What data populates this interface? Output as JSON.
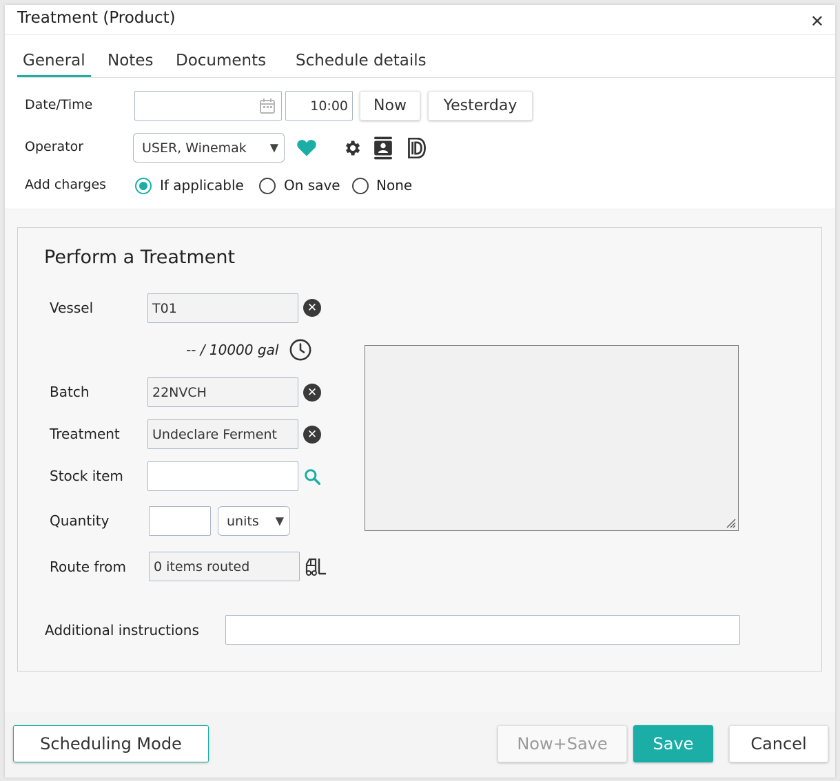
{
  "dialog": {
    "title": "Treatment (Product)",
    "close_glyph": "✕"
  },
  "tabs": [
    {
      "label": "General",
      "active": true
    },
    {
      "label": "Notes"
    },
    {
      "label": "Documents"
    },
    {
      "label": "Schedule details"
    }
  ],
  "header": {
    "datetime_label": "Date/Time",
    "date_value": "",
    "time_value": "10:00",
    "now_label": "Now",
    "yesterday_label": "Yesterday",
    "operator_label": "Operator",
    "operator_value": "USER, Winemak",
    "add_charges_label": "Add charges",
    "charges_options": [
      {
        "label": "If applicable",
        "selected": true
      },
      {
        "label": "On save"
      },
      {
        "label": "None"
      }
    ]
  },
  "form": {
    "heading": "Perform a Treatment",
    "vessel_label": "Vessel",
    "vessel_value": "T01",
    "capacity_text": "-- / 10000 gal",
    "batch_label": "Batch",
    "batch_value": "22NVCH",
    "treatment_label": "Treatment",
    "treatment_value": "Undeclare Ferment",
    "stock_item_label": "Stock item",
    "stock_item_value": "",
    "quantity_label": "Quantity",
    "quantity_value": "",
    "quantity_unit": "units",
    "route_from_label": "Route from",
    "route_from_value": "0 items routed",
    "additional_label": "Additional instructions",
    "additional_value": "",
    "notes_value": ""
  },
  "footer": {
    "scheduling_mode": "Scheduling Mode",
    "now_save": "Now+Save",
    "save": "Save",
    "cancel": "Cancel"
  },
  "colors": {
    "accent": "#1aaea6",
    "field_border": "#a9b8c9",
    "readonly_bg": "#f3f3f3"
  },
  "icons": [
    "close-icon",
    "calendar-icon",
    "heart-icon",
    "gear-icon",
    "contact-card-icon",
    "document-d-icon",
    "clear-icon",
    "clock-icon",
    "search-icon",
    "forklift-icon",
    "dropdown-caret-icon",
    "resize-handle-icon"
  ]
}
